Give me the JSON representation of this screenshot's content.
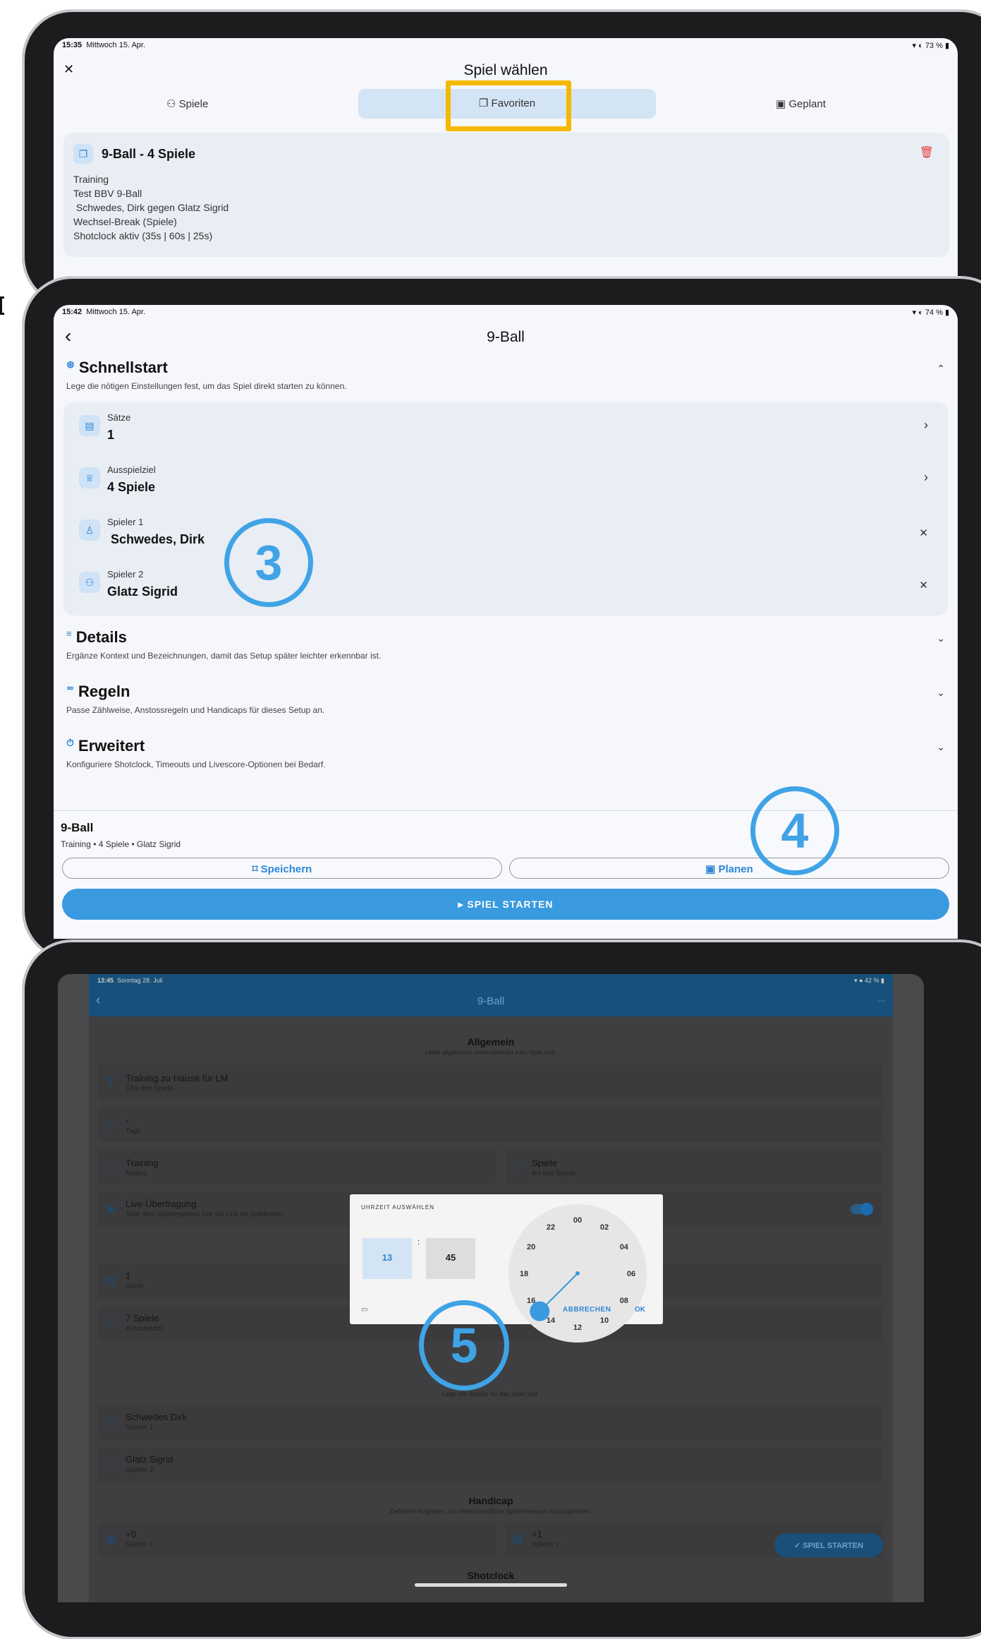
{
  "screen1": {
    "status_time": "15:35",
    "status_date": "Mittwoch 15. Apr.",
    "status_battery": "73 %",
    "close_glyph": "✕",
    "title": "Spiel wählen",
    "tabs": [
      {
        "label": "Spiele"
      },
      {
        "label": "Favoriten"
      },
      {
        "label": "Geplant"
      }
    ],
    "card": {
      "title": "9-Ball - 4 Spiele",
      "lines": [
        "Training",
        "Test BBV 9-Ball",
        " Schwedes, Dirk gegen Glatz Sigrid",
        "Wechsel-Break (Spiele)",
        "Shotclock aktiv (35s | 60s | 25s)"
      ]
    },
    "highlight_color": "#f5b800"
  },
  "screen2": {
    "status_time": "15:42",
    "status_date": "Mittwoch 15. Apr.",
    "status_battery": "74 %",
    "back_glyph": "‹",
    "title": "9-Ball",
    "schnellstart": {
      "title": "Schnellstart",
      "subtitle": "Lege die nötigen Einstellungen fest, um das Spiel direkt starten zu können.",
      "rows": [
        {
          "label": "Sätze",
          "value": "1",
          "action": "›"
        },
        {
          "label": "Ausspielziel",
          "value": "4 Spiele",
          "action": "›"
        },
        {
          "label": "Spieler 1",
          "value": " Schwedes, Dirk",
          "action": "✕"
        },
        {
          "label": "Spieler 2",
          "value": "Glatz Sigrid",
          "action": "✕"
        }
      ]
    },
    "details": {
      "title": "Details",
      "subtitle": "Ergänze Kontext und Bezeichnungen, damit das Setup später leichter erkennbar ist."
    },
    "regeln": {
      "title": "Regeln",
      "subtitle": "Passe Zählweise, Anstossregeln und Handicaps für dieses Setup an."
    },
    "erweitert": {
      "title": "Erweitert",
      "subtitle": "Konfiguriere Shotclock, Timeouts und Livescore-Optionen bei Bedarf."
    },
    "footer": {
      "title": "9-Ball",
      "summary": "Training • 4 Spiele • Glatz Sigrid",
      "save_label": "Speichern",
      "plan_label": "Planen",
      "start_label": "▸ SPIEL STARTEN"
    }
  },
  "screen3": {
    "status_time": "13:45",
    "status_date": "Sonntag 28. Juli",
    "status_battery": "42 %",
    "title": "9-Ball",
    "more_glyph": "···",
    "allgemein": {
      "title": "Allgemein",
      "subtitle": "Halte allgemeine Informationen zum Spiel fest."
    },
    "fields": [
      {
        "value": "Training zu Hause für LM",
        "label": "Titel des Spiels"
      },
      {
        "value": "-",
        "label": "Tags"
      },
      {
        "value": "Training",
        "label": "Modus"
      },
      {
        "value": "Spiele",
        "label": "Art des Spiels"
      },
      {
        "value": "Live-Übertragung",
        "label": "Teile dein Spielergebnis live via Link im Spielmenü"
      },
      {
        "value": "1",
        "label": "Sätze"
      },
      {
        "value": "7 Spiele",
        "label": "Ausspielziel"
      }
    ],
    "spieler_subtitle": "Lege die Spieler für das Spiel fest.",
    "players": [
      {
        "value": "Schwedes Dirk",
        "label": "Spieler 1"
      },
      {
        "value": "Glatz Sigrid",
        "label": "Spieler 2"
      }
    ],
    "handicap": {
      "title": "Handicap",
      "subtitle": "Definiere Vorgaben, um unterschiedliche Spielerniveaus auszugleichen.",
      "items": [
        {
          "value": "+0",
          "label": "Spieler 1"
        },
        {
          "value": "+1",
          "label": "Spieler 2"
        }
      ]
    },
    "shotclock_title": "Shotclock",
    "fab_label": "✓ SPIEL STARTEN",
    "dialog": {
      "header": "UHRZEIT AUSWÄHLEN",
      "hour": "13",
      "minute": "45",
      "cancel": "ABBRECHEN",
      "ok": "OK",
      "clock_numbers": [
        "00",
        "02",
        "04",
        "06",
        "08",
        "10",
        "12",
        "14",
        "16",
        "18",
        "20",
        "22"
      ]
    }
  },
  "annotations": {
    "n3": "3",
    "n4": "4",
    "n5": "5",
    "color": "#3fa3e6"
  }
}
